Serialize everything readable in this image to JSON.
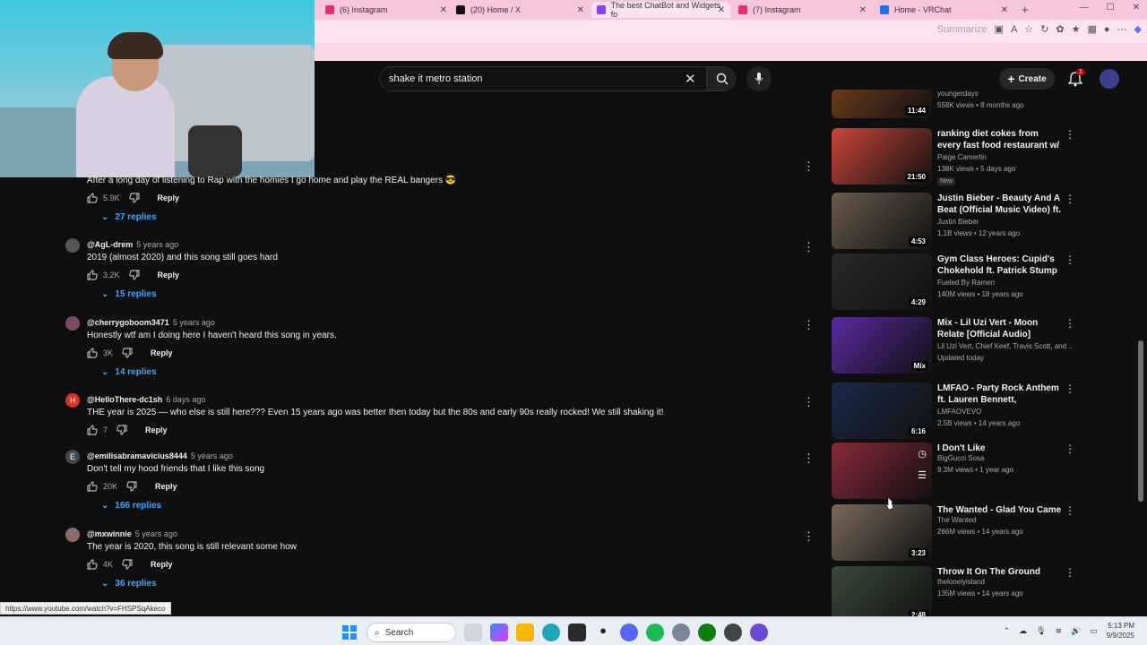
{
  "browser": {
    "tabs": [
      {
        "label": "(6) Instagram",
        "color": "#e1306c"
      },
      {
        "label": "(20) Home / X",
        "color": "#111111"
      },
      {
        "label": "The best ChatBot and Widgets fo",
        "color": "#8a3ffc"
      },
      {
        "label": "(7) Instagram",
        "color": "#e1306c"
      },
      {
        "label": "Home - VRChat",
        "color": "#1a73e8"
      }
    ],
    "address_hint": "Summarize"
  },
  "header": {
    "search_query": "shake it metro station",
    "create_label": "Create",
    "notification_count": "1"
  },
  "comments": [
    {
      "author": "",
      "ago": "",
      "text": "After a long day of listening to Rap with the homies I go home and play the REAL bangers 😎",
      "likes": "5.9K",
      "reply": "Reply",
      "replies": "27 replies",
      "avatar_letter": "",
      "avatar_color": "#0f0f0f"
    },
    {
      "author": "@AgL-drem",
      "ago": "5 years ago",
      "text": "2019 (almost 2020) and this song still goes hard",
      "likes": "3.2K",
      "reply": "Reply",
      "replies": "15 replies",
      "avatar_letter": "",
      "avatar_color": "#555555"
    },
    {
      "author": "@cherrygoboom3471",
      "ago": "5 years ago",
      "text": "Honestly wtf am I doing here I haven't heard this song in years.",
      "likes": "3K",
      "reply": "Reply",
      "replies": "14 replies",
      "avatar_letter": "",
      "avatar_color": "#7a4a6a"
    },
    {
      "author": "@HelloThere-dc1sh",
      "ago": "6 days ago",
      "text": "THE year is 2025 — who else is still here???   Even 15 years ago was better then today but the 80s and early 90s really rocked!  We still shaking it!",
      "likes": "7",
      "reply": "Reply",
      "replies": "",
      "avatar_letter": "H",
      "avatar_color": "#d93025"
    },
    {
      "author": "@emilisabramavicius8444",
      "ago": "5 years ago",
      "text": "Don't tell my hood friends that I like this song",
      "likes": "20K",
      "reply": "Reply",
      "replies": "166 replies",
      "avatar_letter": "E",
      "avatar_color": "#3d4a52"
    },
    {
      "author": "@mxwinnie",
      "ago": "5 years ago",
      "text": "The year is 2020, this song is still relevant some how",
      "likes": "4K",
      "reply": "Reply",
      "replies": "36 replies",
      "avatar_letter": "",
      "avatar_color": "#8a6a6a"
    }
  ],
  "videos": [
    {
      "title": "",
      "channel": "youngerdays",
      "meta": "558K views • 8 months ago",
      "duration": "11:44",
      "thumb": "#6b3a1a",
      "badge": ""
    },
    {
      "title": "ranking diet cokes from every fast food restaurant w/ the boys",
      "channel": "Paige Camerlin",
      "meta": "138K views • 5 days ago",
      "duration": "21:50",
      "thumb": "#c9453a",
      "badge": "New"
    },
    {
      "title": "Justin Bieber - Beauty And A Beat (Official Music Video) ft. ...",
      "channel": "Justin Bieber",
      "meta": "1.1B views • 12 years ago",
      "duration": "4:53",
      "thumb": "#6a5a4a",
      "badge": ""
    },
    {
      "title": "Gym Class Heroes: Cupid's Chokehold ft. Patrick Stump ...",
      "channel": "Fueled By Ramen",
      "meta": "140M views • 18 years ago",
      "duration": "4:29",
      "thumb": "#2a2a2a",
      "badge": ""
    },
    {
      "title": "Mix - Lil Uzi Vert - Moon Relate [Official Audio]",
      "channel": "Lil Uzi Vert, Chief Keef, Travis Scott, and ...",
      "meta": "Updated today",
      "duration": "Mix",
      "thumb": "#5a2aa0",
      "badge": ""
    },
    {
      "title": "LMFAO - Party Rock Anthem ft. Lauren Bennett, GoonRock",
      "channel": "LMFAOVEVO",
      "meta": "2.5B views • 14 years ago",
      "duration": "6:16",
      "thumb": "#1a2a4a",
      "badge": ""
    },
    {
      "title": "I Don't Like",
      "channel": "BigGucci Sosa",
      "meta": "9.3M views • 1 year ago",
      "duration": "",
      "thumb": "#8a2a3a",
      "badge": ""
    },
    {
      "title": "The Wanted - Glad You Came",
      "channel": "The Wanted",
      "meta": "266M views • 14 years ago",
      "duration": "3:23",
      "thumb": "#7a6a5a",
      "badge": ""
    },
    {
      "title": "Throw It On The Ground",
      "channel": "thelonelyisland",
      "meta": "135M views • 14 years ago",
      "duration": "2:48",
      "thumb": "#3a4a3a",
      "badge": ""
    }
  ],
  "status_url": "https://www.youtube.com/watch?v=FHSPSqAkeco",
  "taskbar": {
    "search_label": "Search",
    "time": "5:13 PM",
    "date": "9/9/2025"
  }
}
